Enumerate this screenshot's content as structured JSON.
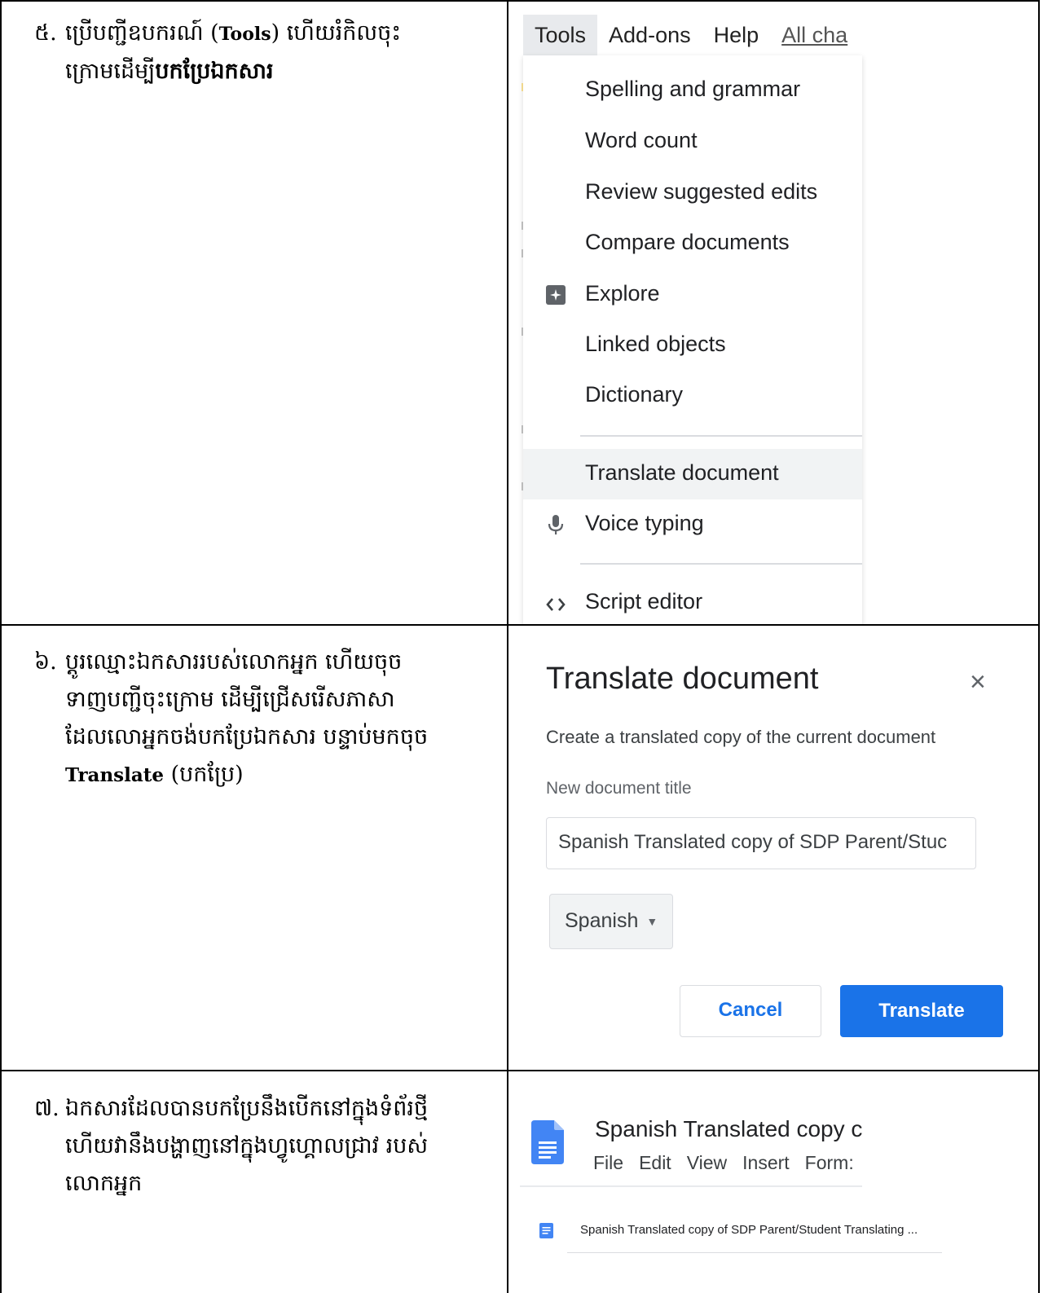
{
  "step5": {
    "num": "៥.",
    "text_a": "ប្រើបញ្ជីឧបករណ៍ (",
    "text_b": "Tools",
    "text_c": ") ហើយរំកិលចុះ",
    "text_d": "ក្រោមដើម្បី",
    "text_e": "បកប្រែឯកសារ"
  },
  "step6": {
    "num": "៦.",
    "line1": "ប្តូរឈ្មោះឯកសាររបស់លោកអ្នក ហើយចុច",
    "line2": "ទាញបញ្ជីចុះក្រោម ដើម្បីជ្រើសរើសភាសា",
    "line3": "ដែលលោអ្នកចង់បកប្រែឯកសារ បន្ទាប់មកចុច",
    "line4_bold": "Translate",
    "line4_rest": " (បកប្រែ)"
  },
  "step7": {
    "num": "៧.",
    "line1": "ឯកសារដែលបានបកប្រែនឹងបើកនៅក្នុងទំព័រថ្មី",
    "line2": "ហើយវានឹងបង្ហាញនៅក្នុងហ្វូហ្គោលជ្រាវ របស់",
    "line3": "លោកអ្នក"
  },
  "tools_menu": {
    "menubar": [
      "Tools",
      "Add-ons",
      "Help",
      "All cha"
    ],
    "items": [
      "Spelling and grammar",
      "Word count",
      "Review suggested edits",
      "Compare documents",
      "Explore",
      "Linked objects",
      "Dictionary",
      "Translate document",
      "Voice typing",
      "Script editor"
    ],
    "highlighted": "Translate document"
  },
  "dialog": {
    "title": "Translate document",
    "close": "×",
    "subtitle": "Create a translated copy of the current document",
    "field_label": "New document title",
    "field_value": "Spanish Translated copy of SDP Parent/Stuc",
    "language": "Spanish",
    "cancel": "Cancel",
    "translate": "Translate"
  },
  "newdoc": {
    "title": "Spanish Translated copy c",
    "menu": [
      "File",
      "Edit",
      "View",
      "Insert",
      "Form:"
    ],
    "list_item": "Spanish Translated copy of SDP Parent/Student Translating ..."
  },
  "colors": {
    "accent": "#1a73e8",
    "doc_icon": "#4285f4",
    "highlight": "#f1f3f4"
  }
}
